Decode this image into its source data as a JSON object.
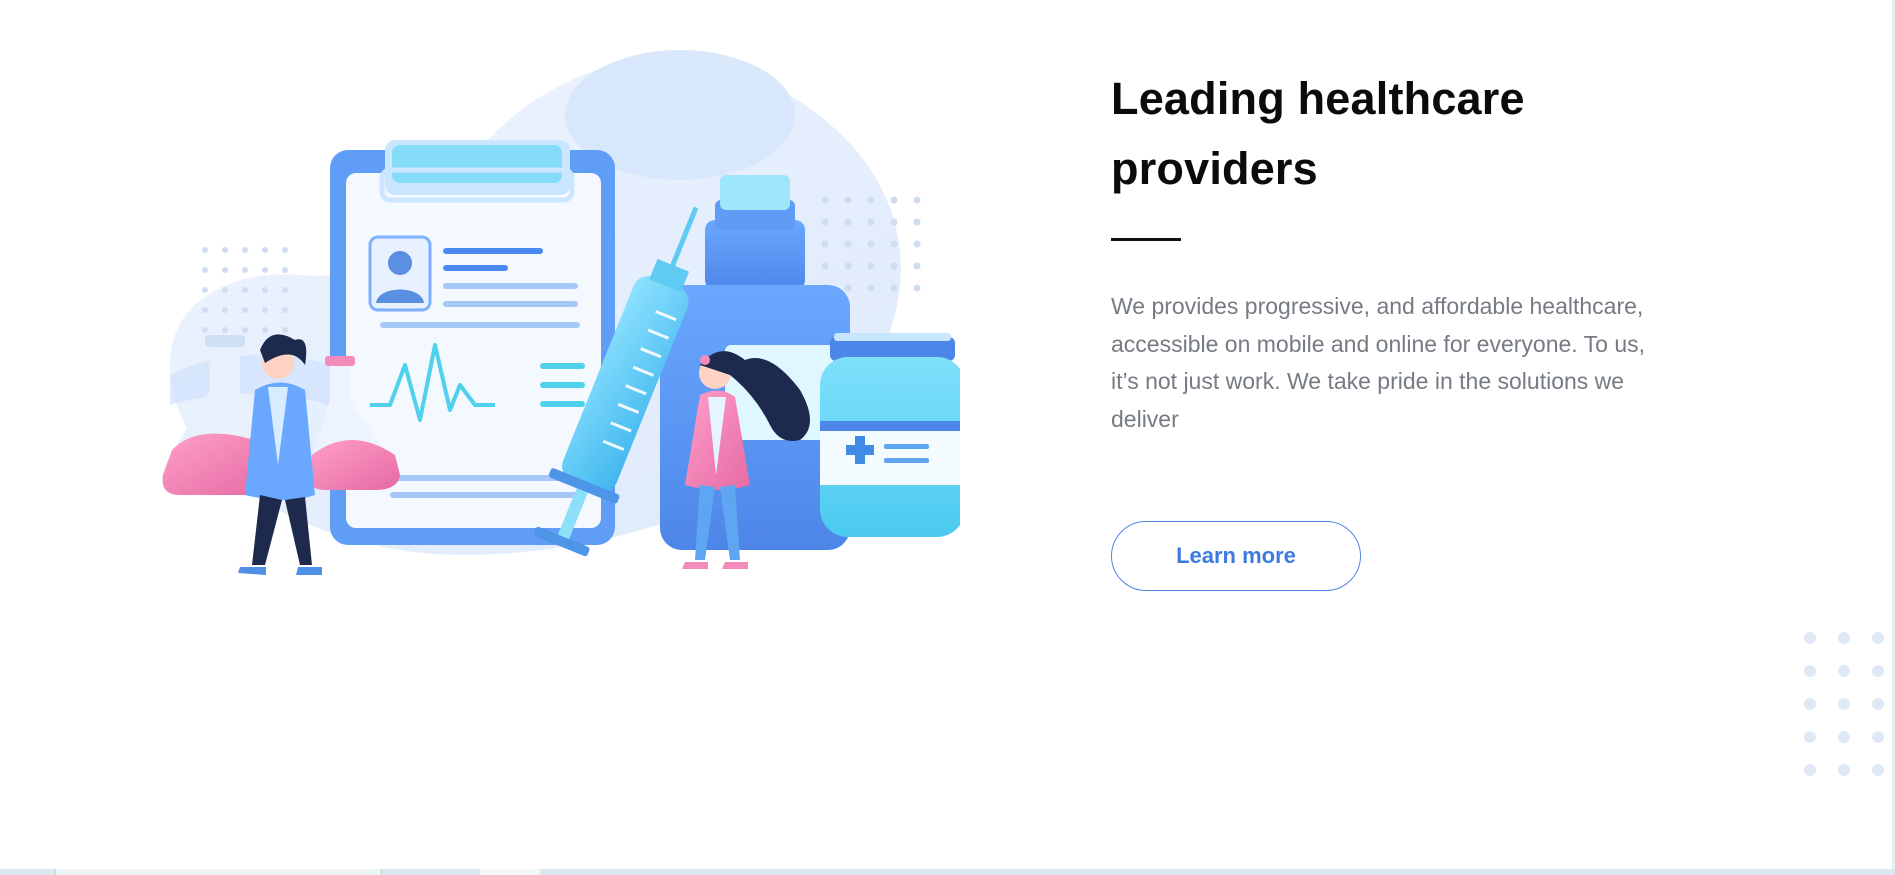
{
  "hero": {
    "title_line1": "Leading healthcare",
    "title_line2": "providers",
    "description": "We provides progressive, and affordable healthcare, accessible on mobile and online for everyone. To us, it’s not just work. We take pride in the solutions we deliver",
    "cta_label": "Learn more"
  },
  "illustration": {
    "subject": "healthcare-illustration"
  },
  "colors": {
    "accent": "#3e7be0",
    "title": "#0b0b0b",
    "body_text": "#767b83",
    "pink": "#f08bb8",
    "light_blue": "#e7f0fd"
  }
}
